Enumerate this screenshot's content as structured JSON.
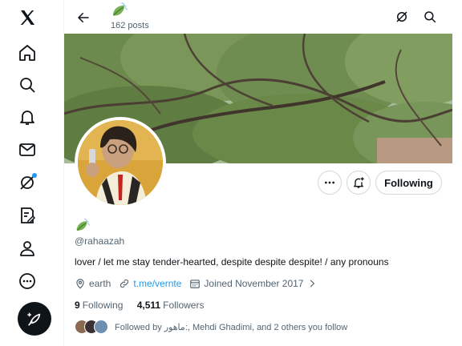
{
  "header": {
    "posts_count": "162 posts"
  },
  "nav": {
    "items": [
      "x-logo",
      "home",
      "explore",
      "notifications",
      "messages",
      "grok",
      "lists",
      "profile",
      "more"
    ]
  },
  "profile": {
    "handle": "@rahaazah",
    "bio": "lover / let me stay tender-hearted, despite despite despite! / any pronouns",
    "location": "earth",
    "link": "t.me/vernte",
    "joined": "Joined November 2017",
    "following_count": "9",
    "following_label": "Following",
    "followers_count": "4,511",
    "followers_label": "Followers",
    "followed_by": "Followed by ماهور:, Mehdi Ghadimi, and 2 others you follow"
  },
  "actions": {
    "following_button": "Following"
  },
  "colors": {
    "accent": "#1d9bf0",
    "text": "#0f1419",
    "secondary": "#536471",
    "border": "#cfd9de"
  }
}
